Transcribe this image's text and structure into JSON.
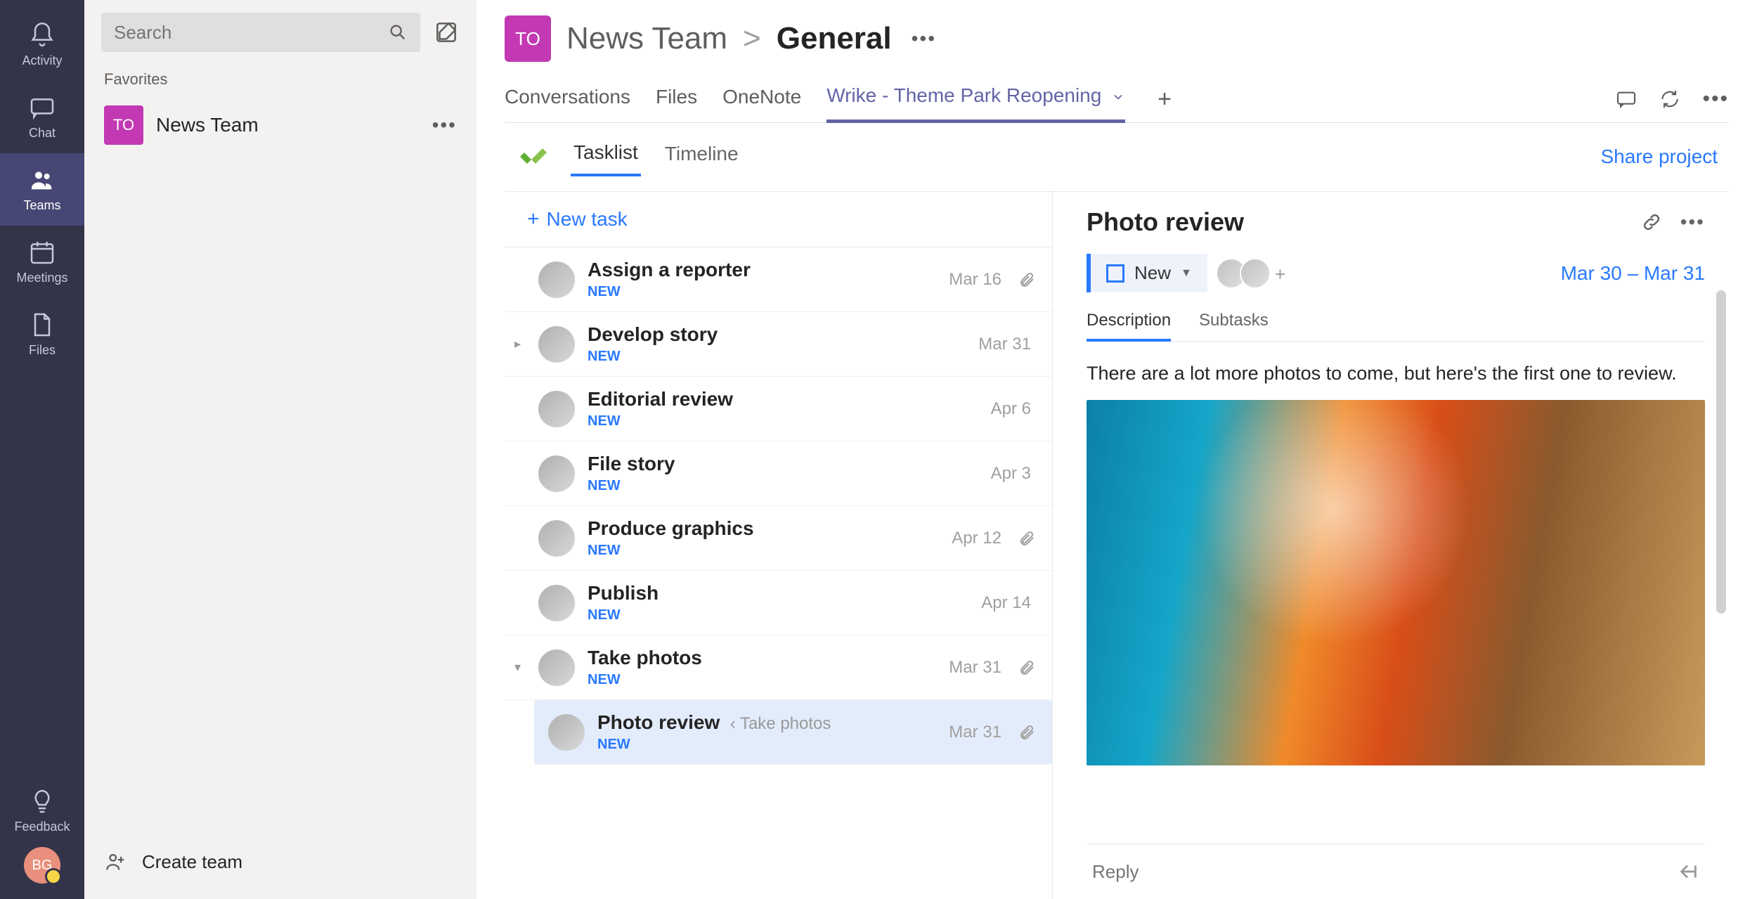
{
  "rail": {
    "items": [
      {
        "label": "Activity"
      },
      {
        "label": "Chat"
      },
      {
        "label": "Teams"
      },
      {
        "label": "Meetings"
      },
      {
        "label": "Files"
      }
    ],
    "feedback_label": "Feedback",
    "avatar_initials": "BG"
  },
  "team_panel": {
    "search_placeholder": "Search",
    "favorites_label": "Favorites",
    "team_badge": "TO",
    "team_name": "News Team",
    "create_team_label": "Create team"
  },
  "header": {
    "badge": "TO",
    "team": "News Team",
    "separator": ">",
    "channel": "General",
    "tabs": [
      "Conversations",
      "Files",
      "OneNote",
      "Wrike - Theme Park Reopening"
    ],
    "active_tab_index": 3
  },
  "wrike": {
    "tabs": [
      "Tasklist",
      "Timeline"
    ],
    "active_tab_index": 0,
    "share_label": "Share project",
    "new_task_label": "New task",
    "tasks": [
      {
        "title": "Assign a reporter",
        "status": "NEW",
        "date": "Mar 16",
        "has_attachment": true,
        "has_caret": false
      },
      {
        "title": "Develop story",
        "status": "NEW",
        "date": "Mar 31",
        "has_attachment": false,
        "has_caret": true,
        "caret": "▸"
      },
      {
        "title": "Editorial review",
        "status": "NEW",
        "date": "Apr 6",
        "has_attachment": false,
        "has_caret": false
      },
      {
        "title": "File story",
        "status": "NEW",
        "date": "Apr 3",
        "has_attachment": false,
        "has_caret": false
      },
      {
        "title": "Produce graphics",
        "status": "NEW",
        "date": "Apr 12",
        "has_attachment": true,
        "has_caret": false
      },
      {
        "title": "Publish",
        "status": "NEW",
        "date": "Apr 14",
        "has_attachment": false,
        "has_caret": false
      },
      {
        "title": "Take photos",
        "status": "NEW",
        "date": "Mar 31",
        "has_attachment": true,
        "has_caret": true,
        "caret": "▾"
      }
    ],
    "subtask": {
      "title": "Photo review",
      "parent_hint": "Take photos",
      "status": "NEW",
      "date": "Mar 31",
      "has_attachment": true
    }
  },
  "detail": {
    "title": "Photo review",
    "status_label": "New",
    "date_range": "Mar 30 – Mar 31",
    "tabs": [
      "Description",
      "Subtasks"
    ],
    "active_tab_index": 0,
    "description": "There are a lot more photos to come, but here's the first one to review.",
    "reply_placeholder": "Reply"
  }
}
